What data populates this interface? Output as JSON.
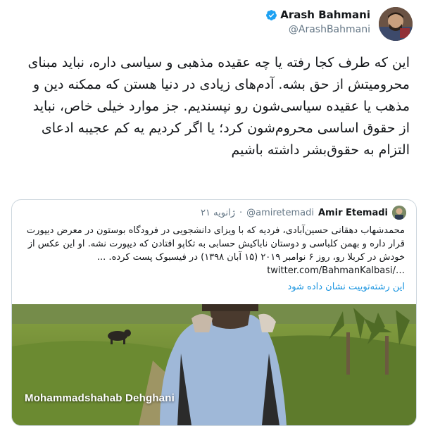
{
  "tweet": {
    "author_name": "Arash Bahmani",
    "author_handle": "@ArashBahmani",
    "text": "این که طرف کجا رفته یا چه عقیده مذهبی و سیاسی داره، نباید مبنای محرومیتش از حق بشه. آدم‌های زیادی در دنیا هستن که ممکنه دین و مذهب یا عقیده سیاسی‌شون رو نپسندیم. جز موارد خیلی خاص، نباید از حقوق اساسی محروم‌شون کرد؛ یا اگر کردیم یه کم عجیبه ادعای التزام به حقوق‌بشر داشته باشیم",
    "accent_color": "#1da1f2",
    "verified_icon": "verified-badge-icon"
  },
  "quoted": {
    "author_name": "Amir Etemadi",
    "author_handle": "@amiretemadi",
    "separator": "·",
    "date": "۲۱ ژانویه",
    "text_main": "محمدشهاب دهقانی حسین‌آبادی، فردیه که با ویزای دانشجویی در فرودگاه بوستون در معرض دیپورت قرار داره و بهمن کلباسی و دوستان ناباکیش حسابی به تکاپو افتادن که دیپورت نشه. او این عکس از خودش در کربلا رو، روز ۶ نوامبر ۲۰۱۹ (۱۵ آبان ۱۳۹۸) در فیسبوک پست کرده. ...",
    "link": "twitter.com/BahmanKalbasi/…",
    "thread_link": "این رشته‌توییت نشان داده شود",
    "image_caption": "Mohammadshahab Dehghani",
    "link_color": "#1b95e0"
  }
}
